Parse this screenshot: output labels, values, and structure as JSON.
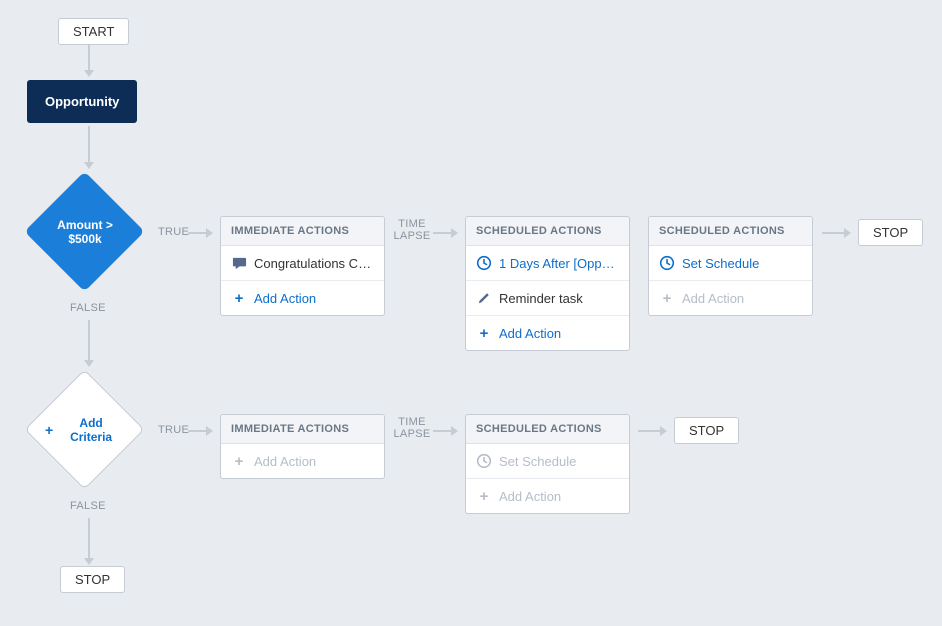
{
  "start_label": "START",
  "trigger_label": "Opportunity",
  "criteria1": {
    "text": "Amount > $500k",
    "true_label": "TRUE",
    "false_label": "FALSE"
  },
  "criteria2": {
    "text": "Add Criteria",
    "true_label": "TRUE",
    "false_label": "FALSE"
  },
  "row1": {
    "immediate": {
      "header": "IMMEDIATE ACTIONS",
      "item1": "Congratulations Ch...",
      "add_action": "Add Action"
    },
    "time_lapse": "TIME LAPSE",
    "sched1": {
      "header": "SCHEDULED ACTIONS",
      "schedule": "1 Days After [Oppo...",
      "item1": "Reminder task",
      "add_action": "Add Action"
    },
    "sched2": {
      "header": "SCHEDULED ACTIONS",
      "schedule": "Set Schedule",
      "add_action": "Add Action"
    },
    "stop_label": "STOP"
  },
  "row2": {
    "immediate": {
      "header": "IMMEDIATE ACTIONS",
      "add_action": "Add Action"
    },
    "time_lapse": "TIME LAPSE",
    "sched1": {
      "header": "SCHEDULED ACTIONS",
      "schedule": "Set Schedule",
      "add_action": "Add Action"
    },
    "stop_label": "STOP"
  },
  "final_stop": "STOP"
}
